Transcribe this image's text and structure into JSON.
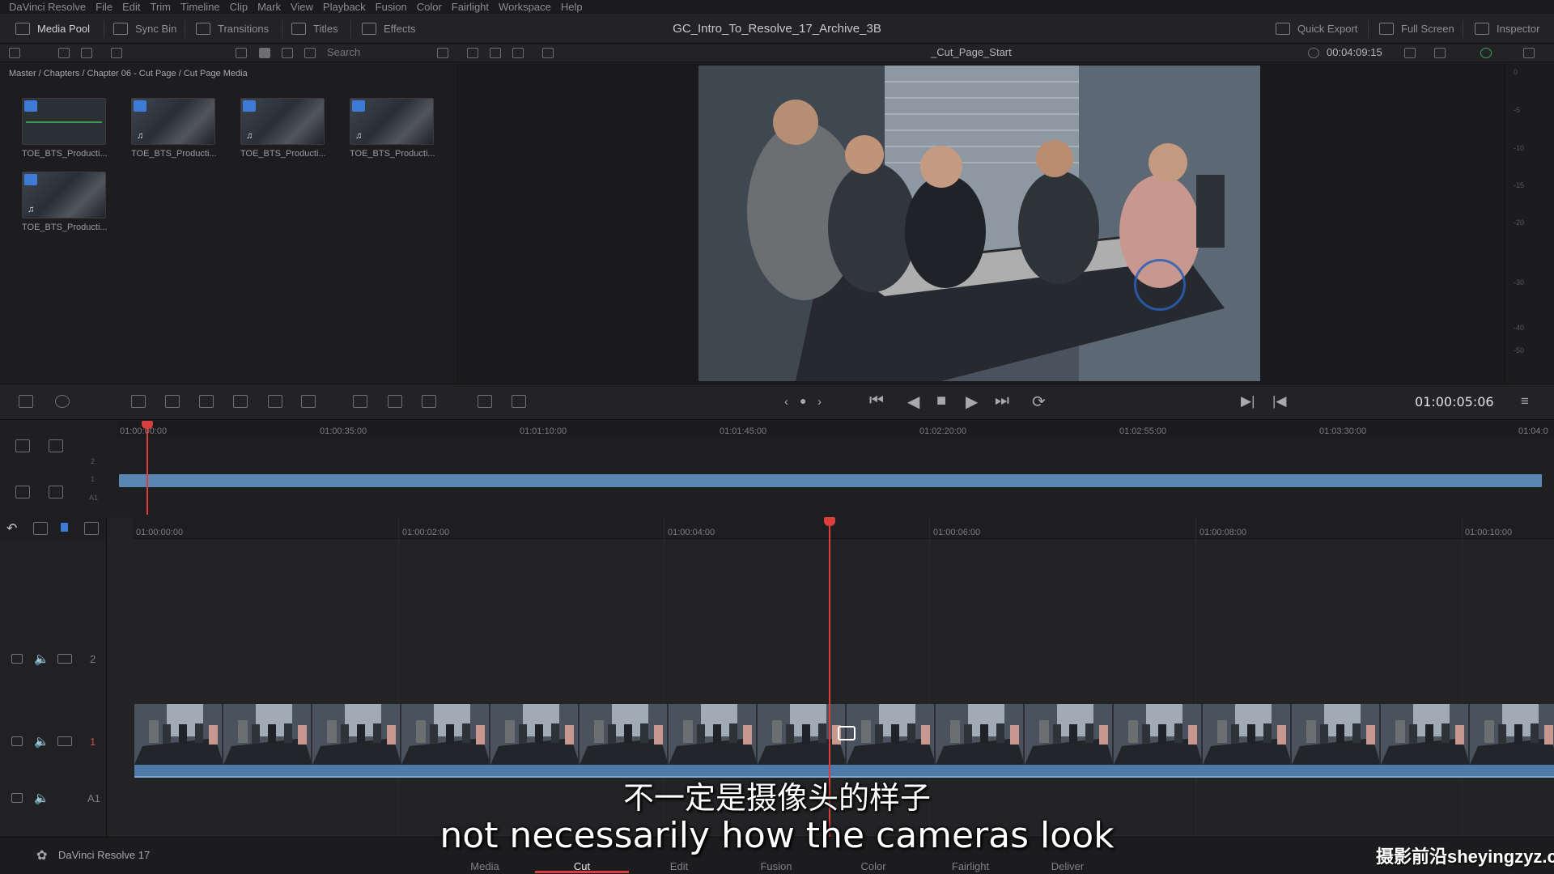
{
  "menubar": {
    "items": [
      "DaVinci Resolve",
      "File",
      "Edit",
      "Trim",
      "Timeline",
      "Clip",
      "Mark",
      "View",
      "Playback",
      "Fusion",
      "Color",
      "Fairlight",
      "Workspace",
      "Help"
    ]
  },
  "toolbar": {
    "media_pool": "Media Pool",
    "sync_bin": "Sync Bin",
    "transitions": "Transitions",
    "titles": "Titles",
    "effects": "Effects",
    "project_title": "GC_Intro_To_Resolve_17_Archive_3B",
    "quick_export": "Quick Export",
    "full_screen": "Full Screen",
    "inspector": "Inspector"
  },
  "subbar": {
    "search_placeholder": "Search",
    "timeline_name": "_Cut_Page_Start",
    "duration": "00:04:09:15"
  },
  "media_pool": {
    "breadcrumb": "Master / Chapters / Chapter 06 - Cut Page / Cut Page Media",
    "clips": [
      {
        "label": "TOE_BTS_Producti..."
      },
      {
        "label": "TOE_BTS_Producti..."
      },
      {
        "label": "TOE_BTS_Producti..."
      },
      {
        "label": "TOE_BTS_Producti..."
      },
      {
        "label": "TOE_BTS_Producti..."
      }
    ]
  },
  "meter": {
    "ticks": [
      "0",
      "-5",
      "-10",
      "-15",
      "-20",
      "-30",
      "-40",
      "-50"
    ]
  },
  "transport": {
    "timecode": "01:00:05:06"
  },
  "upper_timeline": {
    "ticks": [
      "01:00:00:00",
      "01:00:35:00",
      "01:01:10:00",
      "01:01:45:00",
      "01:02:20:00",
      "01:02:55:00",
      "01:03:30:00",
      "01:04:0"
    ],
    "track_numbers": [
      "2",
      "1",
      "A1"
    ]
  },
  "lower_timeline": {
    "ticks": [
      "01:00:00:00",
      "01:00:02:00",
      "01:00:04:00",
      "01:00:06:00",
      "01:00:08:00",
      "01:00:10:00"
    ],
    "tracks": [
      {
        "label": "2"
      },
      {
        "label": "1"
      },
      {
        "label": "A1"
      }
    ]
  },
  "pages": {
    "app_name": "DaVinci Resolve 17",
    "tabs": [
      "Media",
      "Cut",
      "Edit",
      "Fusion",
      "Color",
      "Fairlight",
      "Deliver"
    ],
    "active": "Cut"
  },
  "subtitles": {
    "chinese": "不一定是摄像头的样子",
    "english": "not necessarily how the cameras look"
  },
  "watermark": "摄影前沿sheyingzyz.com",
  "colors": {
    "accent_blue": "#3d7bd6",
    "playhead_red": "#d9403d",
    "clip_blue": "#5a86b3"
  }
}
